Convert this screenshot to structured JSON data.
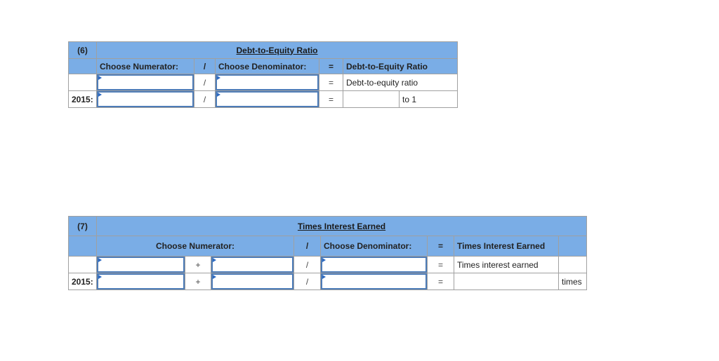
{
  "section6": {
    "number": "(6)",
    "title": "Debt-to-Equity Ratio",
    "headers": {
      "numerator": "Choose Numerator:",
      "divide": "/",
      "denominator": "Choose Denominator:",
      "equals": "=",
      "result": "Debt-to-Equity Ratio"
    },
    "rows": [
      {
        "label": "",
        "numerator": "",
        "divide": "/",
        "denominator": "",
        "equals": "=",
        "result": "Debt-to-equity ratio",
        "suffix": ""
      },
      {
        "label": "2015:",
        "numerator": "",
        "divide": "/",
        "denominator": "",
        "equals": "=",
        "result": "",
        "suffix": "to 1"
      }
    ]
  },
  "section7": {
    "number": "(7)",
    "title": "Times Interest Earned",
    "headers": {
      "numerator": "Choose Numerator:",
      "divide": "/",
      "denominator": "Choose Denominator:",
      "equals": "=",
      "result": "Times Interest Earned"
    },
    "rows": [
      {
        "label": "",
        "num1": "",
        "plus": "+",
        "num2": "",
        "divide": "/",
        "denominator": "",
        "equals": "=",
        "result": "Times interest earned",
        "suffix": ""
      },
      {
        "label": "2015:",
        "num1": "",
        "plus": "+",
        "num2": "",
        "divide": "/",
        "denominator": "",
        "equals": "=",
        "result": "",
        "suffix": "times"
      }
    ]
  }
}
